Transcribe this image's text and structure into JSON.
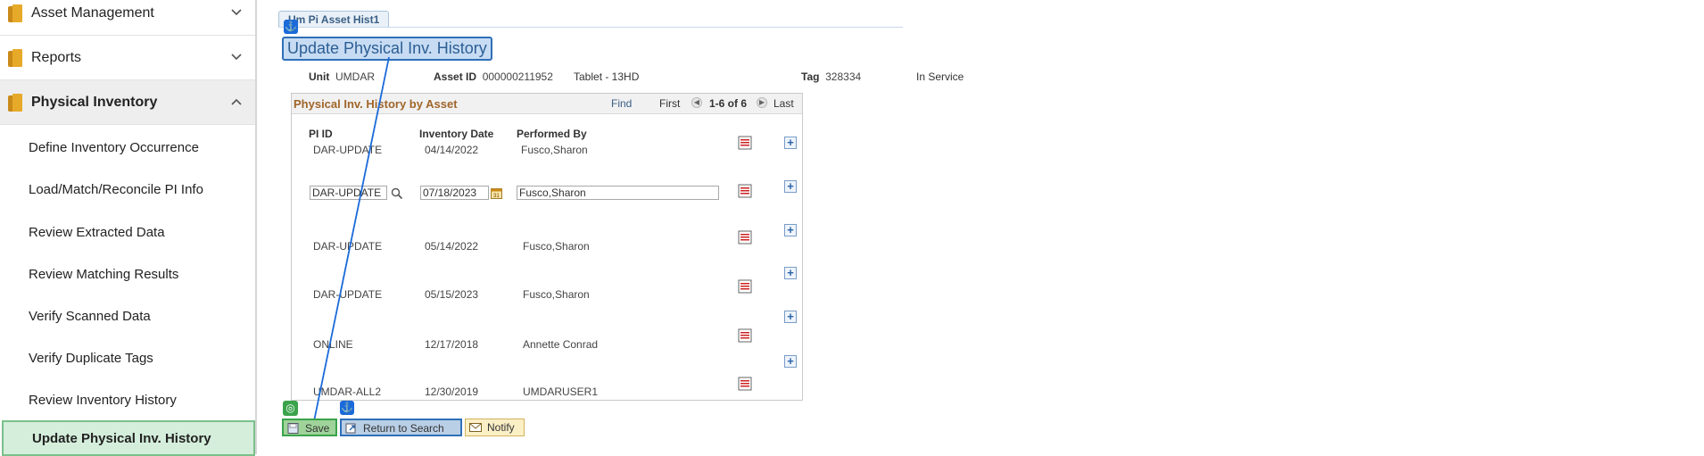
{
  "sidebar": {
    "sections": [
      {
        "label": "Asset Management",
        "expanded": false
      },
      {
        "label": "Reports",
        "expanded": false
      },
      {
        "label": "Physical Inventory",
        "expanded": true
      }
    ],
    "items": [
      {
        "label": "Define Inventory Occurrence"
      },
      {
        "label": "Load/Match/Reconcile PI Info"
      },
      {
        "label": "Review Extracted Data"
      },
      {
        "label": "Review Matching Results"
      },
      {
        "label": "Verify Scanned Data"
      },
      {
        "label": "Verify Duplicate Tags"
      },
      {
        "label": "Review Inventory History"
      },
      {
        "label": "Update Physical Inv. History",
        "active": true
      }
    ]
  },
  "tab": {
    "label": "Um Pi Asset Hist1"
  },
  "page": {
    "title": "Update Physical Inv. History"
  },
  "header": {
    "unit_label": "Unit",
    "unit_value": "UMDAR",
    "asset_label": "Asset ID",
    "asset_value": "000000211952",
    "asset_desc": "Tablet - 13HD",
    "tag_label": "Tag",
    "tag_value": "328334",
    "status": "In Service"
  },
  "grid": {
    "title": "Physical Inv. History by Asset",
    "find": "Find",
    "first": "First",
    "range": "1-6 of 6",
    "last": "Last",
    "columns": [
      "PI ID",
      "Inventory Date",
      "Performed By"
    ],
    "rows": [
      {
        "pi_id": "DAR-UPDATE",
        "date": "04/14/2022",
        "by": "Fusco,Sharon",
        "editable": false
      },
      {
        "pi_id": "DAR-UPDATE",
        "date": "07/18/2023",
        "by": "Fusco,Sharon",
        "editable": true
      },
      {
        "pi_id": "DAR-UPDATE",
        "date": "05/14/2022",
        "by": "Fusco,Sharon",
        "editable": false
      },
      {
        "pi_id": "DAR-UPDATE",
        "date": "05/15/2023",
        "by": "Fusco,Sharon",
        "editable": false
      },
      {
        "pi_id": "ONLINE",
        "date": "12/17/2018",
        "by": "Annette Conrad",
        "editable": false
      },
      {
        "pi_id": "UMDAR-ALL2",
        "date": "12/30/2019",
        "by": "UMDARUSER1",
        "editable": false
      }
    ]
  },
  "buttons": {
    "save": "Save",
    "return": "Return to Search",
    "notify": "Notify"
  },
  "colors": {
    "accent": "#2f6fb8",
    "active_item": "#d4eedb",
    "grid_title": "#a0652a"
  }
}
